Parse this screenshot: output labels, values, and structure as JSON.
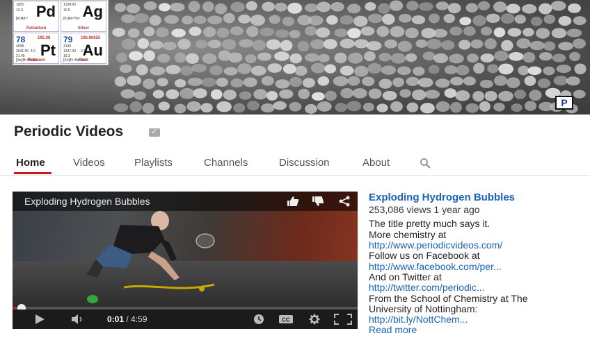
{
  "banner": {
    "tiles": [
      {
        "number": "",
        "symbol": "Pd",
        "name": "Palladium",
        "mass": "",
        "lines": [
          "1825",
          "12.0",
          "[Kr]4d¹⁰"
        ]
      },
      {
        "number": "",
        "symbol": "Ag",
        "name": "Silver",
        "mass": "",
        "lines": [
          "1234.93",
          "10.5",
          "[Kr]4d¹⁰5s¹"
        ]
      },
      {
        "number": "78",
        "symbol": "Pt",
        "name": "Platinum",
        "mass": "195.08",
        "lines": [
          "4098",
          "2041.55",
          "21.45",
          "[Xe]4f¹⁴5d⁹6s¹"
        ],
        "extra": "4.2"
      },
      {
        "number": "79",
        "symbol": "Au",
        "name": "Gold",
        "mass": "196.96655",
        "lines": [
          "3130",
          "1337.33",
          "19.3",
          "[Xe]4f¹⁴5d¹⁰6s¹"
        ],
        "extra": "3.1"
      }
    ],
    "logo_letter": "P"
  },
  "channel": {
    "title": "Periodic Videos"
  },
  "tabs": [
    {
      "label": "Home",
      "active": true
    },
    {
      "label": "Videos"
    },
    {
      "label": "Playlists"
    },
    {
      "label": "Channels"
    },
    {
      "label": "Discussion"
    },
    {
      "label": "About"
    }
  ],
  "player": {
    "title": "Exploding Hydrogen Bubbles",
    "current_time": "0:01",
    "duration": "/ 4:59",
    "progress": 0.003
  },
  "video": {
    "title": "Exploding Hydrogen Bubbles",
    "meta": "253,086 views  1 year ago",
    "description": [
      {
        "text": "The title pretty much says it.",
        "link": false
      },
      {
        "text": "More chemistry at",
        "link": false
      },
      {
        "text": "http://www.periodicvideos.com/",
        "link": true
      },
      {
        "text": "Follow us on Facebook at",
        "link": false
      },
      {
        "text": "http://www.facebook.com/per...",
        "link": true
      },
      {
        "text": "And on Twitter at",
        "link": false
      },
      {
        "text": "http://twitter.com/periodic...",
        "link": true
      },
      {
        "text": "From the School of Chemistry at The",
        "link": false
      },
      {
        "text": "University of Nottingham:",
        "link": false
      },
      {
        "text": "http://bit.ly/NottChem...",
        "link": true
      }
    ],
    "read_more": "Read more"
  },
  "colors": {
    "accent": "#cc181e",
    "link": "#1a63b8"
  }
}
